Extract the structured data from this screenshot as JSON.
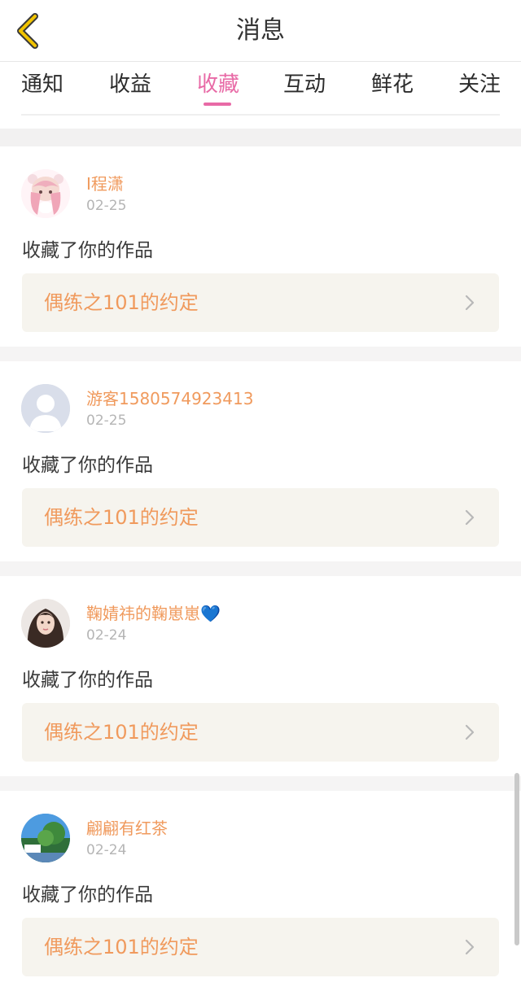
{
  "header": {
    "title": "消息",
    "back_icon": "chevron-left-icon"
  },
  "tabs": [
    {
      "label": "通知"
    },
    {
      "label": "收益"
    },
    {
      "label": "收藏",
      "active": true
    },
    {
      "label": "互动"
    },
    {
      "label": "鲜花"
    },
    {
      "label": "关注"
    }
  ],
  "items": [
    {
      "username": "I程潇",
      "date": "02-25",
      "action": "收藏了你的作品",
      "work_title": "偶练之101的约定",
      "avatar": "anime-figure-avatar"
    },
    {
      "username": "游客1580574923413",
      "date": "02-25",
      "action": "收藏了你的作品",
      "work_title": "偶练之101的约定",
      "avatar": "default-user-avatar"
    },
    {
      "username": "鞠婧祎的鞠崽崽💙",
      "date": "02-24",
      "action": "收藏了你的作品",
      "work_title": "偶练之101的约定",
      "avatar": "portrait-photo-avatar"
    },
    {
      "username": "翩翩有红茶",
      "date": "02-24",
      "action": "收藏了你的作品",
      "work_title": "偶练之101的约定",
      "avatar": "landscape-photo-avatar"
    }
  ],
  "colors": {
    "accent": "#e86aa6",
    "username": "#f09a5d",
    "back_icon": "#f2c400",
    "card_link_bg": "#f6f4ee"
  }
}
